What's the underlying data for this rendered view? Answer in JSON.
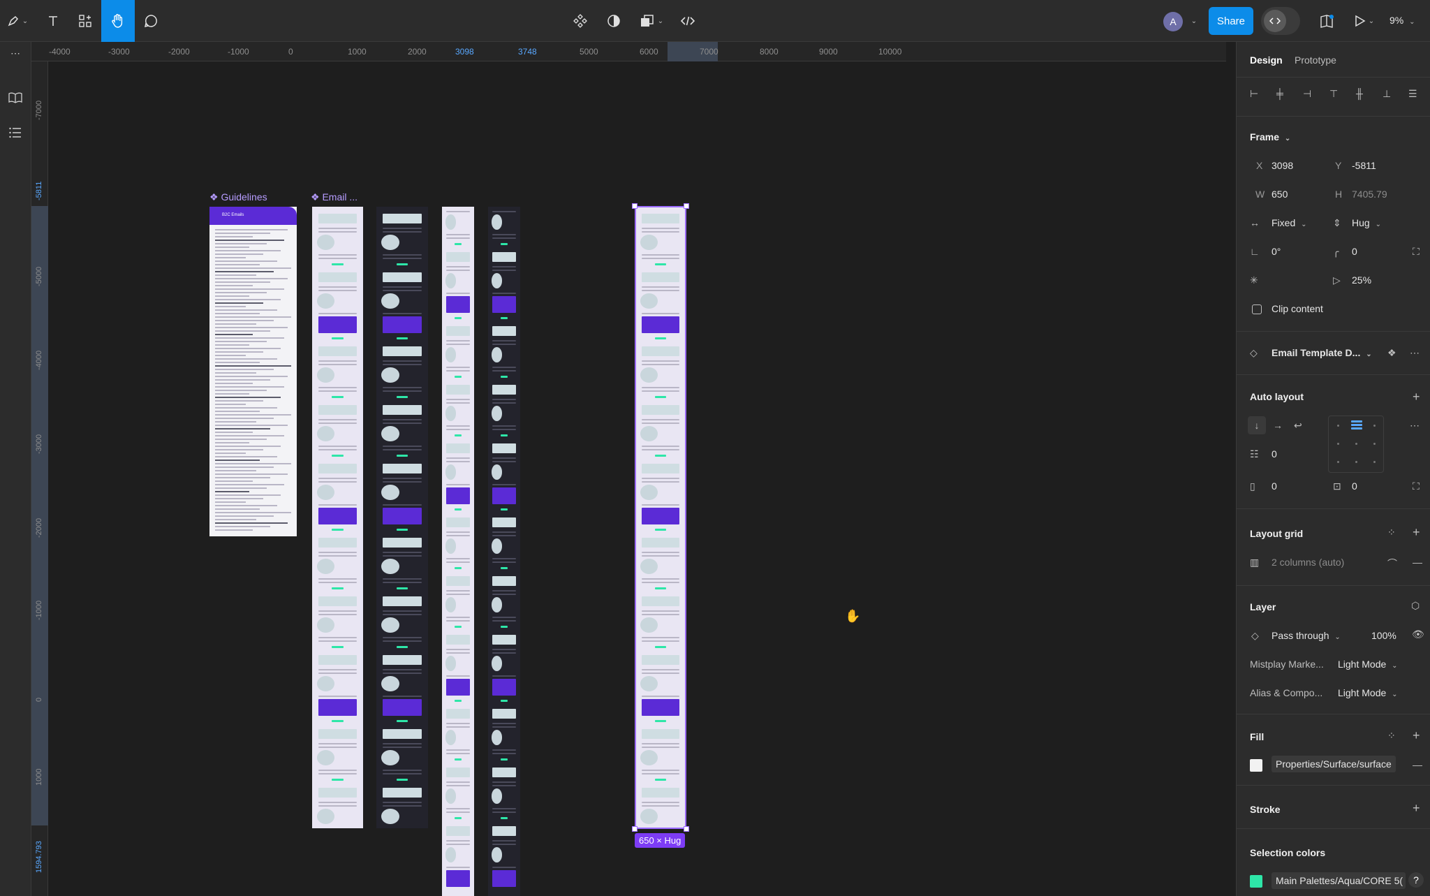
{
  "toolbar": {
    "share_label": "Share",
    "avatar_initial": "A",
    "zoom": "9%"
  },
  "ruler": {
    "top_ticks": [
      "-4000",
      "-3000",
      "-2000",
      "-1000",
      "0",
      "1000",
      "2000",
      "3098",
      "3748",
      "5000",
      "6000",
      "7000",
      "8000",
      "9000",
      "10000"
    ],
    "left_ticks": [
      "-7000",
      "-5811",
      "-5000",
      "-4000",
      "-3000",
      "-2000",
      "-1000",
      "0",
      "1000",
      "1594.793"
    ]
  },
  "canvas": {
    "frames": [
      {
        "label": "Guidelines",
        "title": "B2C Emails"
      },
      {
        "label": "Email ..."
      }
    ],
    "size_badge": "650 × Hug"
  },
  "panel": {
    "tabs": {
      "design": "Design",
      "prototype": "Prototype"
    },
    "frame": {
      "title": "Frame",
      "x_label": "X",
      "x": "3098",
      "y_label": "Y",
      "y": "-5811",
      "w_label": "W",
      "w": "650",
      "h_label": "H",
      "h": "7405.79",
      "width_mode": "Fixed",
      "height_mode": "Hug",
      "rotation": "0°",
      "radius": "0",
      "opacity": "25%",
      "clip_content": "Clip content"
    },
    "component": {
      "name": "Email Template D..."
    },
    "auto_layout": {
      "title": "Auto layout",
      "gap": "0",
      "padding_h": "0",
      "padding_v": "0"
    },
    "layout_grid": {
      "title": "Layout grid",
      "grid": "2 columns (auto)"
    },
    "layer": {
      "title": "Layer",
      "blend": "Pass through",
      "opacity": "100%",
      "modes": [
        {
          "name": "Mistplay Marke...",
          "value": "Light Mode"
        },
        {
          "name": "Alias & Compo...",
          "value": "Light Mode"
        }
      ]
    },
    "fill": {
      "title": "Fill",
      "style": "Properties/Surface/surface",
      "color": "#f2f2f2"
    },
    "stroke": {
      "title": "Stroke"
    },
    "selection_colors": {
      "title": "Selection colors",
      "style": "Main Palettes/Aqua/CORE 5(",
      "color": "#2ee6a8"
    },
    "help": "?"
  }
}
